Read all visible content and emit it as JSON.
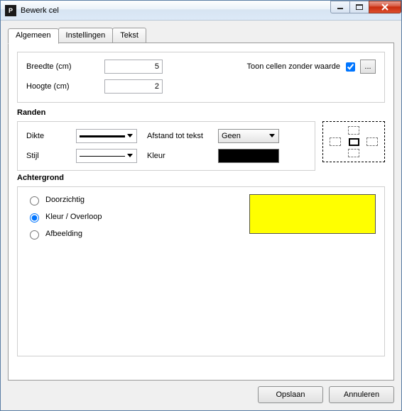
{
  "window": {
    "title": "Bewerk cel",
    "app_icon_letter": "P"
  },
  "tabs": [
    {
      "label": "Algemeen",
      "active": true
    },
    {
      "label": "Instellingen",
      "active": false
    },
    {
      "label": "Tekst",
      "active": false
    }
  ],
  "general": {
    "breedte_label": "Breedte (cm)",
    "breedte_value": "5",
    "hoogte_label": "Hoogte (cm)",
    "hoogte_value": "2",
    "toon_label": "Toon cellen zonder waarde",
    "toon_checked": true,
    "ellipsis": "..."
  },
  "randen": {
    "title": "Randen",
    "dikte_label": "Dikte",
    "stijl_label": "Stijl",
    "afstand_label": "Afstand tot tekst",
    "afstand_value": "Geen",
    "kleur_label": "Kleur",
    "kleur_value": "#000000"
  },
  "achtergrond": {
    "title": "Achtergrond",
    "options": [
      {
        "label": "Doorzichtig",
        "checked": false
      },
      {
        "label": "Kleur / Overloop",
        "checked": true
      },
      {
        "label": "Afbeelding",
        "checked": false
      }
    ],
    "preview_color": "#ffff00"
  },
  "footer": {
    "save": "Opslaan",
    "cancel": "Annuleren"
  }
}
